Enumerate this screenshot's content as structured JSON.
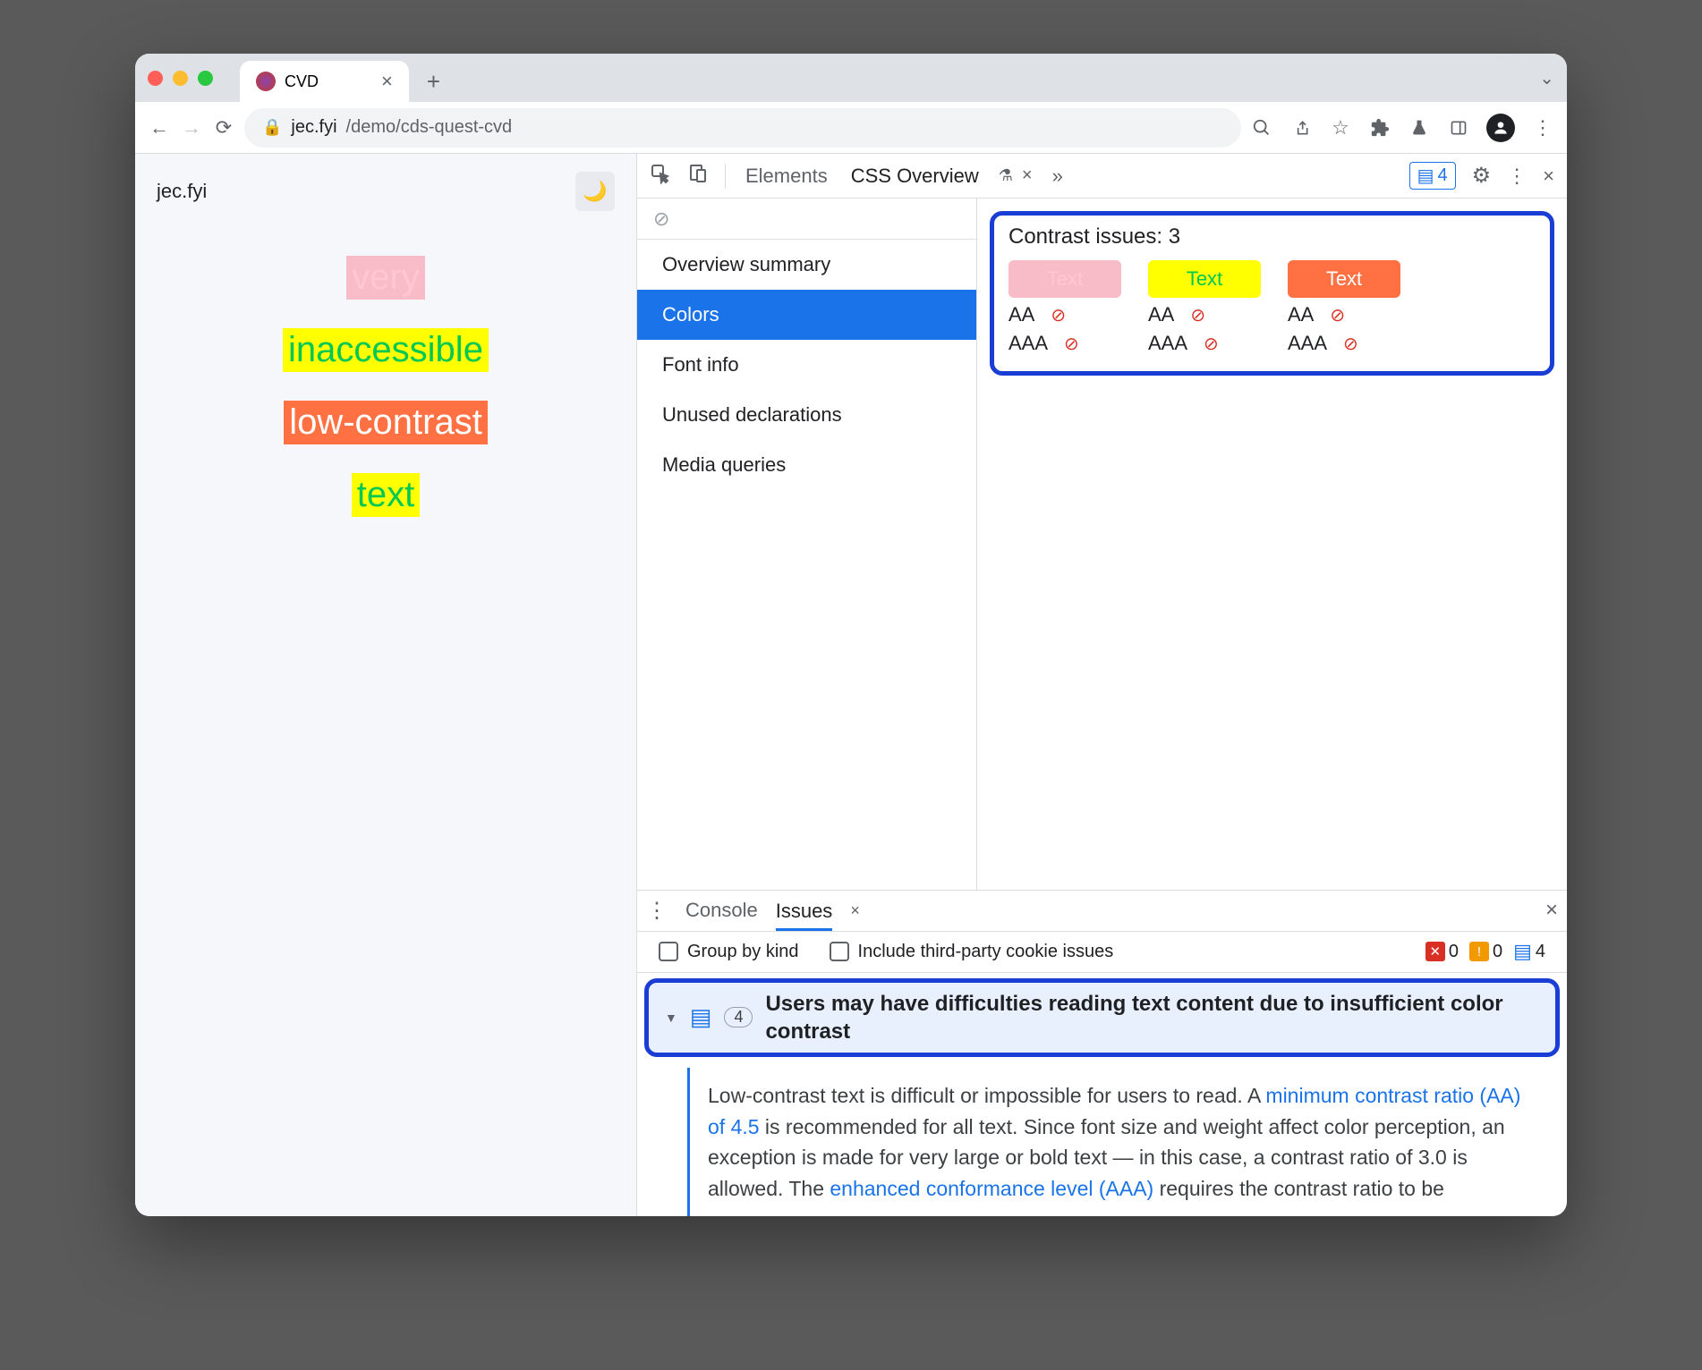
{
  "window": {
    "tab_title": "CVD",
    "url_host": "jec.fyi",
    "url_path": "/demo/cds-quest-cvd"
  },
  "page": {
    "site_title": "jec.fyi",
    "demo_words": {
      "w1": "very",
      "w2": "inaccessible",
      "w3": "low-contrast",
      "w4": "text"
    }
  },
  "devtools": {
    "tabs": {
      "elements": "Elements",
      "css_overview": "CSS Overview"
    },
    "more_tabs_glyph": "»",
    "issue_badge_count": "4"
  },
  "css_overview": {
    "nav": {
      "overview": "Overview summary",
      "colors": "Colors",
      "font_info": "Font info",
      "unused": "Unused declarations",
      "media": "Media queries"
    },
    "contrast": {
      "title": "Contrast issues: 3",
      "swatch_label": "Text",
      "aa": "AA",
      "aaa": "AAA"
    }
  },
  "drawer": {
    "tabs": {
      "console": "Console",
      "issues": "Issues"
    },
    "filters": {
      "group": "Group by kind",
      "third_party": "Include third-party cookie issues"
    },
    "counts": {
      "errors": "0",
      "warnings": "0",
      "info": "4"
    },
    "issue": {
      "count": "4",
      "title": "Users may have difficulties reading text content due to insufficient color contrast",
      "body_1": "Low-contrast text is difficult or impossible for users to read. A ",
      "link_1": "minimum contrast ratio (AA) of 4.5",
      "body_2": " is recommended for all text. Since font size and weight affect color perception, an exception is made for very large or bold text — in this case, a contrast ratio of 3.0 is allowed. The ",
      "link_2": "enhanced conformance level (AAA)",
      "body_3": " requires the contrast ratio to be"
    }
  }
}
